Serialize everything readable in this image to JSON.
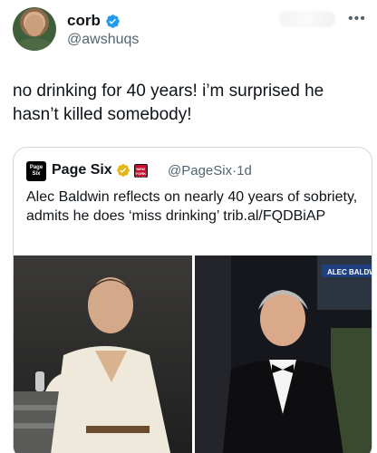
{
  "author": {
    "name": "corb",
    "handle": "@awshuqs",
    "verified": true
  },
  "header": {
    "more_icon": "more-icon"
  },
  "tweet": {
    "text": "no drinking for 40 years! i’m surprised he hasn’t killed somebody!"
  },
  "quote": {
    "avatar_text": "Page Six",
    "name": "Page Six",
    "handle": "@PageSix",
    "separator": "·",
    "time": "1d",
    "badge": "gold-verified-badge",
    "affiliate_badge": "New York Post",
    "text": "Alec Baldwin reflects on nearly 40 years of sobriety, admits he does ‘miss drinking’ trib.al/FQDBiAP"
  },
  "photos": {
    "right_banner": "ALEC BALDWIN"
  },
  "colors": {
    "verified_blue": "#1d9bf0",
    "gold_badge": "#e2b719",
    "secondary_text": "#536471",
    "border": "#cfd9de"
  }
}
